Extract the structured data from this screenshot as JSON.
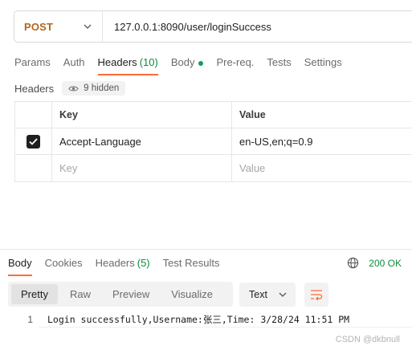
{
  "request": {
    "method": "POST",
    "url": "127.0.0.1:8090/user/loginSuccess"
  },
  "request_tabs": [
    {
      "label": "Params"
    },
    {
      "label": "Auth"
    },
    {
      "label": "Headers",
      "count": "(10)"
    },
    {
      "label": "Body"
    },
    {
      "label": "Pre-req."
    },
    {
      "label": "Tests"
    },
    {
      "label": "Settings"
    }
  ],
  "headers_section": {
    "title": "Headers",
    "hidden_label": "9 hidden",
    "col_key": "Key",
    "col_value": "Value",
    "rows": [
      {
        "checked": true,
        "key": "Accept-Language",
        "value": "en-US,en;q=0.9"
      }
    ],
    "placeholder_key": "Key",
    "placeholder_value": "Value"
  },
  "response_tabs": [
    {
      "label": "Body"
    },
    {
      "label": "Cookies"
    },
    {
      "label": "Headers",
      "count": "(5)"
    },
    {
      "label": "Test Results"
    }
  ],
  "status": {
    "code_text": "200 OK",
    "color": "#0f8a3b"
  },
  "view_modes": [
    {
      "label": "Pretty"
    },
    {
      "label": "Raw"
    },
    {
      "label": "Preview"
    },
    {
      "label": "Visualize"
    }
  ],
  "format_select": {
    "value": "Text"
  },
  "response_body": {
    "line_number": "1",
    "text": "Login successfully,Username:张三,Time: 3/28/24 11:51 PM"
  },
  "watermark": "CSDN @dkbnull",
  "colors": {
    "accent": "#ff6c37",
    "method": "#b5651d",
    "success": "#0f8a3b"
  }
}
